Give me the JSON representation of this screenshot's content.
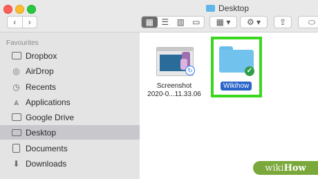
{
  "window": {
    "title": "Desktop"
  },
  "toolbar": {
    "back": "‹",
    "forward": "›",
    "views": [
      "▦",
      "☰",
      "▥",
      "▭"
    ],
    "group_label": "▦ ▾",
    "action_label": "⚙ ▾",
    "share_label": "⇪",
    "tag_label": "⬭"
  },
  "sidebar": {
    "section": "Favourites",
    "items": [
      {
        "label": "Dropbox",
        "icon": "folder-icon"
      },
      {
        "label": "AirDrop",
        "icon": "airdrop-icon"
      },
      {
        "label": "Recents",
        "icon": "clock-icon"
      },
      {
        "label": "Applications",
        "icon": "applications-icon"
      },
      {
        "label": "Google Drive",
        "icon": "folder-icon"
      },
      {
        "label": "Desktop",
        "icon": "desktop-icon",
        "selected": true
      },
      {
        "label": "Documents",
        "icon": "document-icon"
      },
      {
        "label": "Downloads",
        "icon": "download-icon"
      }
    ]
  },
  "files": {
    "screenshot_name_line1": "Screenshot",
    "screenshot_name_line2": "2020-0...11.33.06",
    "folder_name": "Wikihow"
  },
  "watermark": {
    "prefix": "wiki",
    "suffix": "How"
  },
  "colors": {
    "highlight": "#3bd71f",
    "selection": "#2a66c9",
    "folder": "#71c3ee"
  }
}
